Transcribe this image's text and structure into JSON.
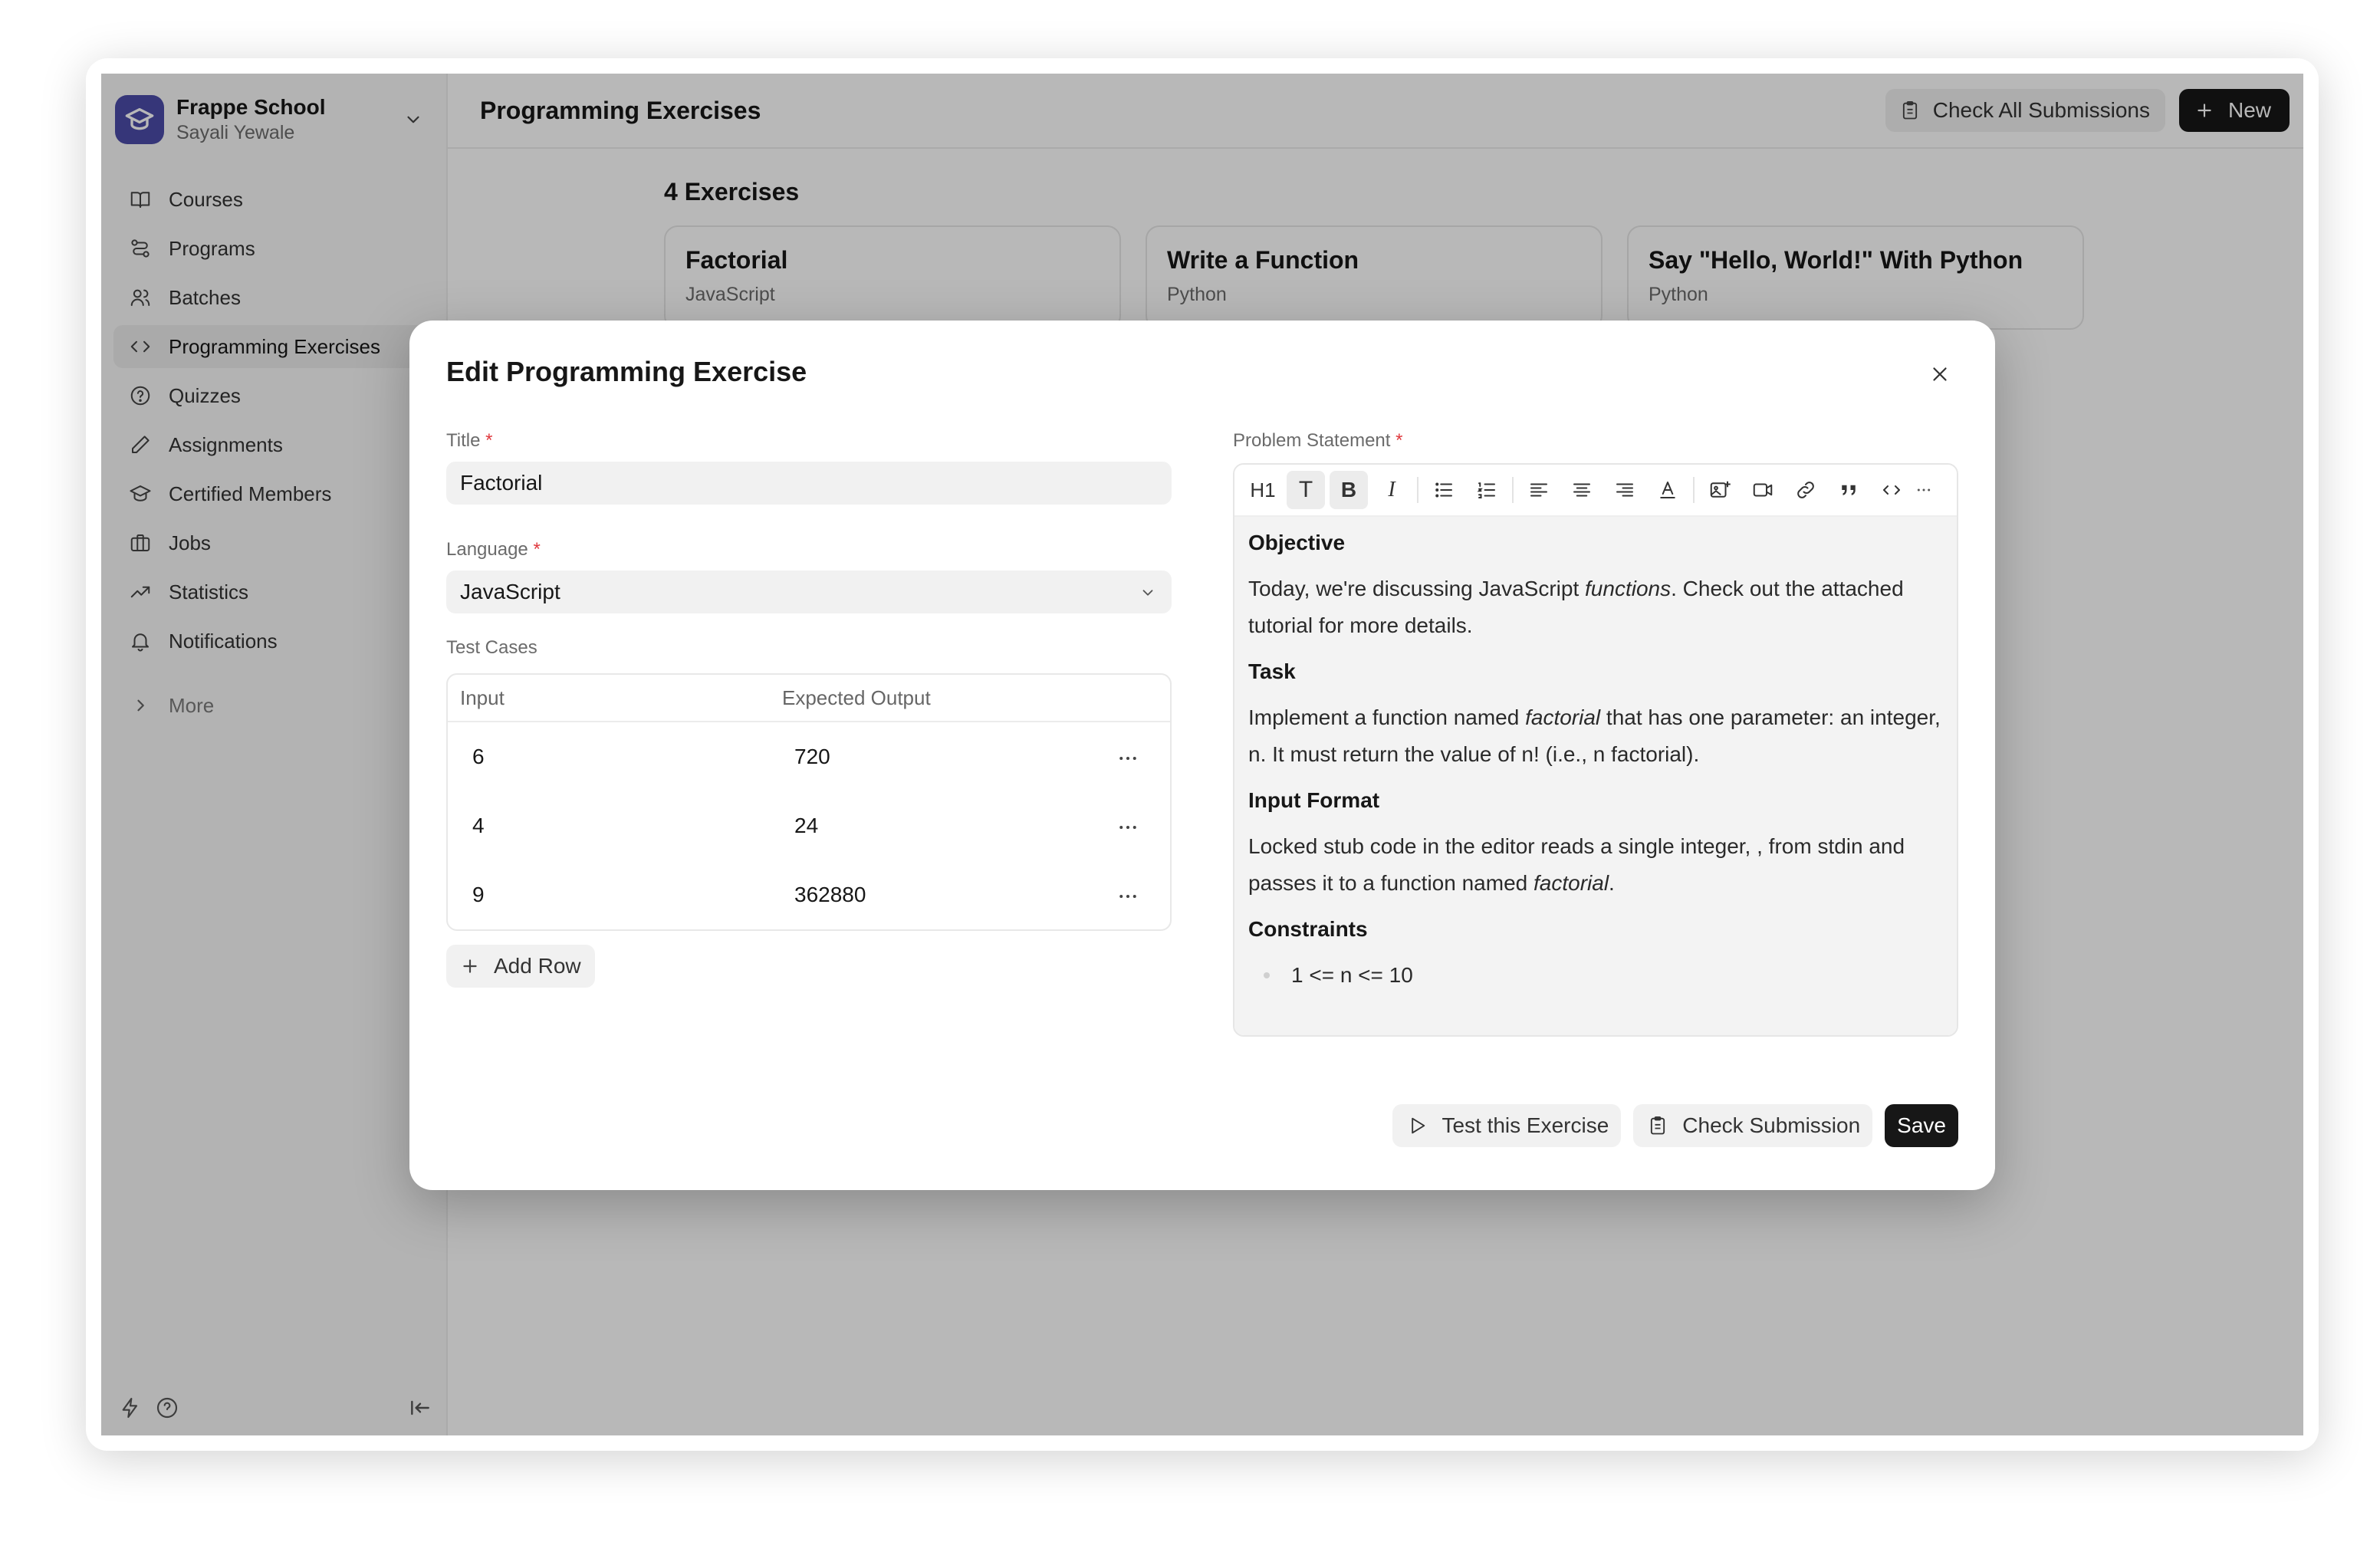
{
  "sidebar": {
    "workspace_name": "Frappe School",
    "workspace_user": "Sayali Yewale",
    "items": [
      {
        "label": "Courses",
        "icon": "book-icon"
      },
      {
        "label": "Programs",
        "icon": "route-icon"
      },
      {
        "label": "Batches",
        "icon": "users-icon"
      },
      {
        "label": "Programming Exercises",
        "icon": "code-icon"
      },
      {
        "label": "Quizzes",
        "icon": "help-circle-icon"
      },
      {
        "label": "Assignments",
        "icon": "pencil-icon"
      },
      {
        "label": "Certified Members",
        "icon": "graduation-cap-icon"
      },
      {
        "label": "Jobs",
        "icon": "briefcase-icon"
      },
      {
        "label": "Statistics",
        "icon": "trending-up-icon"
      },
      {
        "label": "Notifications",
        "icon": "bell-icon"
      }
    ],
    "more_label": "More"
  },
  "header": {
    "title": "Programming Exercises",
    "check_all_label": "Check All Submissions",
    "new_label": "New"
  },
  "list": {
    "count_label": "4 Exercises",
    "cards": [
      {
        "title": "Factorial",
        "language": "JavaScript"
      },
      {
        "title": "Write a Function",
        "language": "Python"
      },
      {
        "title": "Say \"Hello, World!\" With Python",
        "language": "Python"
      }
    ]
  },
  "modal": {
    "title": "Edit Programming Exercise",
    "title_label": "Title",
    "title_value": "Factorial",
    "language_label": "Language",
    "language_value": "JavaScript",
    "test_cases_label": "Test Cases",
    "columns": [
      "Input",
      "Expected Output"
    ],
    "rows": [
      {
        "input": "6",
        "output": "720"
      },
      {
        "input": "4",
        "output": "24"
      },
      {
        "input": "9",
        "output": "362880"
      }
    ],
    "add_row_label": "Add Row",
    "problem_label": "Problem Statement",
    "required_mark": "*",
    "toolbar": {
      "h1": "H1",
      "text": "T",
      "bold": "B",
      "italic": "I"
    },
    "problem": {
      "objective_heading": "Objective",
      "objective_pre": "Today, we're discussing JavaScript ",
      "objective_em": "functions",
      "objective_post": ". Check out the attached tutorial for more details.",
      "task_heading": "Task",
      "task_pre": "Implement a function named ",
      "task_em": "factorial",
      "task_post": " that has one parameter: an integer, n. It must return the value of n! (i.e., n factorial).",
      "input_heading": "Input Format",
      "input_pre": "Locked stub code in the editor reads a single integer, , from stdin and passes it to a function named ",
      "input_em": "factorial",
      "input_post": ".",
      "constraints_heading": "Constraints",
      "constraint_1": "1 <= n <= 10"
    },
    "test_label": "Test this Exercise",
    "check_label": "Check Submission",
    "save_label": "Save"
  },
  "colors": {
    "accent": "#171717",
    "logo": "#4b4ba8",
    "required": "#e0393e"
  }
}
